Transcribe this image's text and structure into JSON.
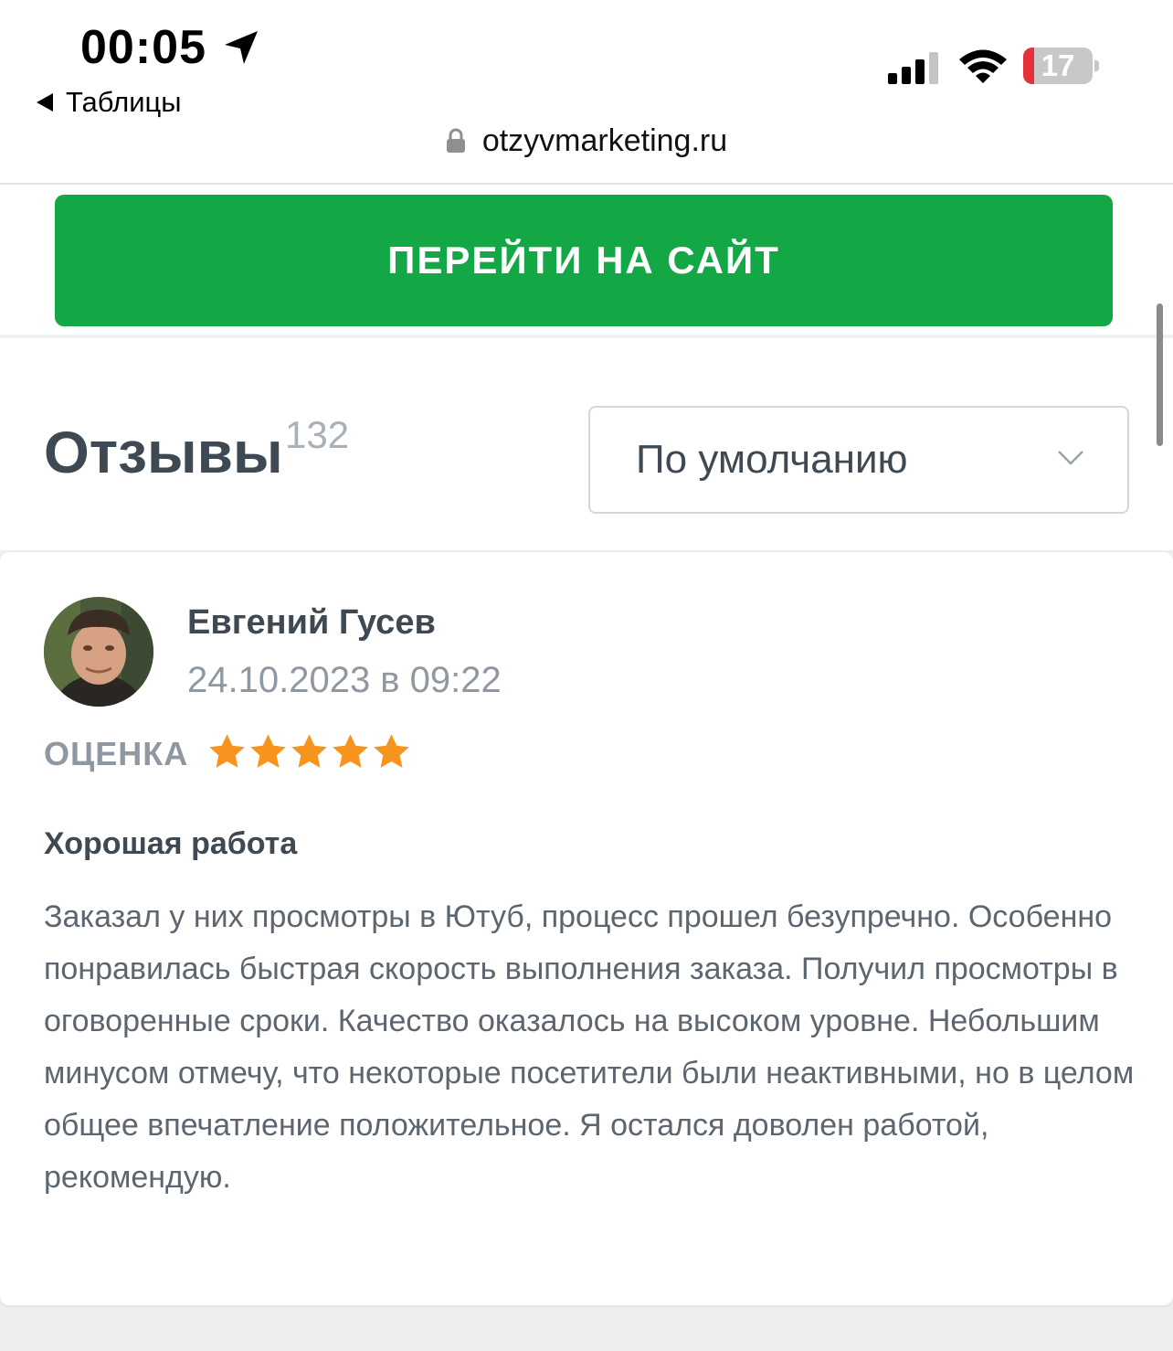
{
  "status_bar": {
    "time": "00:05",
    "back_app": "Таблицы",
    "battery": "17",
    "icons": [
      "location-arrow-icon",
      "signal-icon",
      "wifi-icon",
      "battery-icon"
    ]
  },
  "browser": {
    "url": "otzyvmarketing.ru"
  },
  "cta": {
    "label": "ПЕРЕЙТИ НА САЙТ",
    "color": "#14a745"
  },
  "reviews": {
    "title": "Отзывы",
    "count": "132",
    "sort": {
      "selected": "По умолчанию"
    }
  },
  "review": {
    "author": "Евгений Гусев",
    "date": "24.10.2023 в 09:22",
    "rating_label": "ОЦЕНКА",
    "rating": 5,
    "rating_max": 5,
    "star_color": "#f7941d",
    "title": "Хорошая работа",
    "body": "Заказал у них просмотры в Ютуб, процесс прошел безупречно. Особенно понравилась быстрая скорость выполнения заказа. Получил просмотры в оговоренные сроки. Качество оказалось на высоком уровне. Небольшим минусом отмечу, что некоторые посетители были неактивными, но в целом общее впечатление положительное. Я остался доволен работой, рекомендую."
  }
}
